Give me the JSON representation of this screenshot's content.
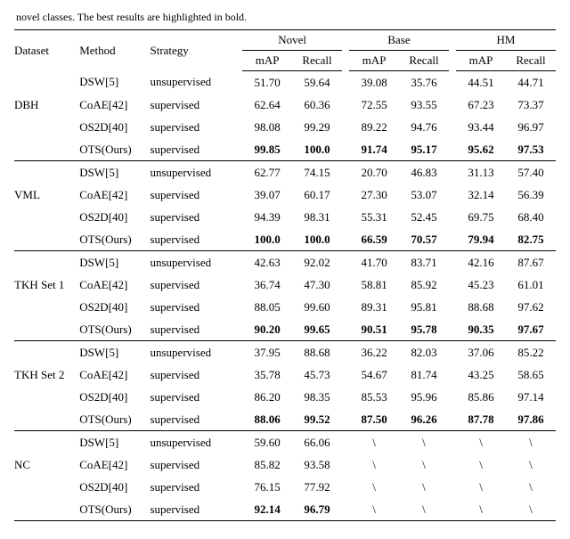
{
  "caption_fragment": "novel classes.  The best results are highlighted in bold.",
  "headers": {
    "dataset": "Dataset",
    "method": "Method",
    "strategy": "Strategy",
    "novel": "Novel",
    "base": "Base",
    "hm": "HM",
    "map": "mAP",
    "recall": "Recall"
  },
  "chart_data": {
    "type": "table",
    "groups": [
      {
        "dataset": "DBH",
        "rows": [
          {
            "method": "DSW[5]",
            "strategy": "unsupervised",
            "novel_map": "51.70",
            "novel_rec": "59.64",
            "base_map": "39.08",
            "base_rec": "35.76",
            "hm_map": "44.51",
            "hm_rec": "44.71",
            "bold": false
          },
          {
            "method": "CoAE[42]",
            "strategy": "supervised",
            "novel_map": "62.64",
            "novel_rec": "60.36",
            "base_map": "72.55",
            "base_rec": "93.55",
            "hm_map": "67.23",
            "hm_rec": "73.37",
            "bold": false
          },
          {
            "method": "OS2D[40]",
            "strategy": "supervised",
            "novel_map": "98.08",
            "novel_rec": "99.29",
            "base_map": "89.22",
            "base_rec": "94.76",
            "hm_map": "93.44",
            "hm_rec": "96.97",
            "bold": false
          },
          {
            "method": "OTS(Ours)",
            "strategy": "supervised",
            "novel_map": "99.85",
            "novel_rec": "100.0",
            "base_map": "91.74",
            "base_rec": "95.17",
            "hm_map": "95.62",
            "hm_rec": "97.53",
            "bold": true
          }
        ]
      },
      {
        "dataset": "VML",
        "rows": [
          {
            "method": "DSW[5]",
            "strategy": "unsupervised",
            "novel_map": "62.77",
            "novel_rec": "74.15",
            "base_map": "20.70",
            "base_rec": "46.83",
            "hm_map": "31.13",
            "hm_rec": "57.40",
            "bold": false
          },
          {
            "method": "CoAE[42]",
            "strategy": "supervised",
            "novel_map": "39.07",
            "novel_rec": "60.17",
            "base_map": "27.30",
            "base_rec": "53.07",
            "hm_map": "32.14",
            "hm_rec": "56.39",
            "bold": false
          },
          {
            "method": "OS2D[40]",
            "strategy": "supervised",
            "novel_map": "94.39",
            "novel_rec": "98.31",
            "base_map": "55.31",
            "base_rec": "52.45",
            "hm_map": "69.75",
            "hm_rec": "68.40",
            "bold": false
          },
          {
            "method": "OTS(Ours)",
            "strategy": "supervised",
            "novel_map": "100.0",
            "novel_rec": "100.0",
            "base_map": "66.59",
            "base_rec": "70.57",
            "hm_map": "79.94",
            "hm_rec": "82.75",
            "bold": true
          }
        ]
      },
      {
        "dataset": "TKH Set 1",
        "rows": [
          {
            "method": "DSW[5]",
            "strategy": "unsupervised",
            "novel_map": "42.63",
            "novel_rec": "92.02",
            "base_map": "41.70",
            "base_rec": "83.71",
            "hm_map": "42.16",
            "hm_rec": "87.67",
            "bold": false
          },
          {
            "method": "CoAE[42]",
            "strategy": "supervised",
            "novel_map": "36.74",
            "novel_rec": "47.30",
            "base_map": "58.81",
            "base_rec": "85.92",
            "hm_map": "45.23",
            "hm_rec": "61.01",
            "bold": false
          },
          {
            "method": "OS2D[40]",
            "strategy": "supervised",
            "novel_map": "88.05",
            "novel_rec": "99.60",
            "base_map": "89.31",
            "base_rec": "95.81",
            "hm_map": "88.68",
            "hm_rec": "97.62",
            "bold": false
          },
          {
            "method": "OTS(Ours)",
            "strategy": "supervised",
            "novel_map": "90.20",
            "novel_rec": "99.65",
            "base_map": "90.51",
            "base_rec": "95.78",
            "hm_map": "90.35",
            "hm_rec": "97.67",
            "bold": true
          }
        ]
      },
      {
        "dataset": "TKH Set 2",
        "rows": [
          {
            "method": "DSW[5]",
            "strategy": "unsupervised",
            "novel_map": "37.95",
            "novel_rec": "88.68",
            "base_map": "36.22",
            "base_rec": "82.03",
            "hm_map": "37.06",
            "hm_rec": "85.22",
            "bold": false
          },
          {
            "method": "CoAE[42]",
            "strategy": "supervised",
            "novel_map": "35.78",
            "novel_rec": "45.73",
            "base_map": "54.67",
            "base_rec": "81.74",
            "hm_map": "43.25",
            "hm_rec": "58.65",
            "bold": false
          },
          {
            "method": "OS2D[40]",
            "strategy": "supervised",
            "novel_map": "86.20",
            "novel_rec": "98.35",
            "base_map": "85.53",
            "base_rec": "95.96",
            "hm_map": "85.86",
            "hm_rec": "97.14",
            "bold": false
          },
          {
            "method": "OTS(Ours)",
            "strategy": "supervised",
            "novel_map": "88.06",
            "novel_rec": "99.52",
            "base_map": "87.50",
            "base_rec": "96.26",
            "hm_map": "87.78",
            "hm_rec": "97.86",
            "bold": true
          }
        ]
      },
      {
        "dataset": "NC",
        "rows": [
          {
            "method": "DSW[5]",
            "strategy": "unsupervised",
            "novel_map": "59.60",
            "novel_rec": "66.06",
            "base_map": "\\",
            "base_rec": "\\",
            "hm_map": "\\",
            "hm_rec": "\\",
            "bold": false
          },
          {
            "method": "CoAE[42]",
            "strategy": "supervised",
            "novel_map": "85.82",
            "novel_rec": "93.58",
            "base_map": "\\",
            "base_rec": "\\",
            "hm_map": "\\",
            "hm_rec": "\\",
            "bold": false
          },
          {
            "method": "OS2D[40]",
            "strategy": "supervised",
            "novel_map": "76.15",
            "novel_rec": "77.92",
            "base_map": "\\",
            "base_rec": "\\",
            "hm_map": "\\",
            "hm_rec": "\\",
            "bold": false
          },
          {
            "method": "OTS(Ours)",
            "strategy": "supervised",
            "novel_map": "92.14",
            "novel_rec": "96.79",
            "base_map": "\\",
            "base_rec": "\\",
            "hm_map": "\\",
            "hm_rec": "\\",
            "bold": true,
            "bold_novel_only": true
          }
        ]
      }
    ]
  }
}
